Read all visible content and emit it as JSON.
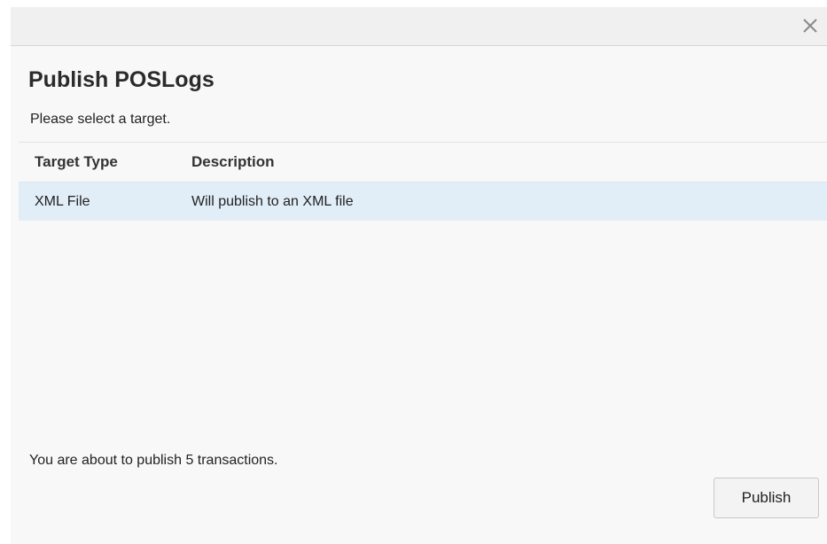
{
  "dialog": {
    "title": "Publish POSLogs",
    "close_icon": "close-icon",
    "instruction": "Please select a target."
  },
  "table": {
    "columns": [
      "Target Type",
      "Description"
    ],
    "rows": [
      {
        "target_type": "XML File",
        "description": "Will publish to an XML file",
        "selected": true
      }
    ]
  },
  "summary": "You are about to publish 5 transactions.",
  "actions": {
    "publish_label": "Publish"
  },
  "colors": {
    "selected_row": "#e1eef8",
    "dialog_background": "#f8f8f8",
    "titlebar_background": "#f0f0f0"
  }
}
